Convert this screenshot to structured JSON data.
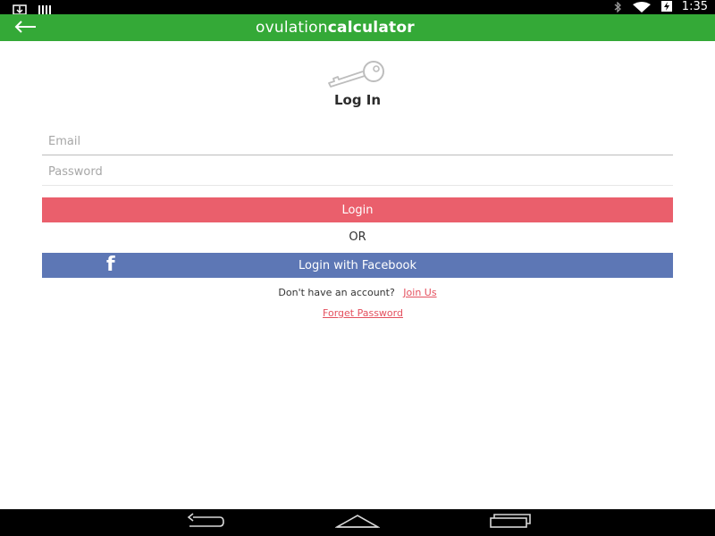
{
  "status_bar": {
    "time": "1:35",
    "left_icons": [
      "download-icon",
      "barcode-icon"
    ],
    "right_icons": [
      "bluetooth-icon",
      "wifi-icon",
      "battery-charging-icon"
    ]
  },
  "app_bar": {
    "back_icon": "arrow-left-icon",
    "brand_light": "ovulation",
    "brand_bold": "calculator",
    "color": "#34a937"
  },
  "login": {
    "icon": "key-icon",
    "title": "Log In",
    "email_placeholder": "Email",
    "email_value": "",
    "password_placeholder": "Password",
    "password_value": "",
    "login_button": "Login",
    "login_color": "#ea5f6c",
    "or_text": "OR",
    "facebook_icon_glyph": "f",
    "facebook_button": "Login with Facebook",
    "facebook_color": "#5d77b5",
    "no_account_text": "Don't have an account?",
    "join_link": "Join Us",
    "forget_link": "Forget Password",
    "link_color": "#e4505e"
  },
  "nav_bar": {
    "buttons": [
      "back-nav-icon",
      "home-nav-icon",
      "recent-apps-icon"
    ]
  }
}
